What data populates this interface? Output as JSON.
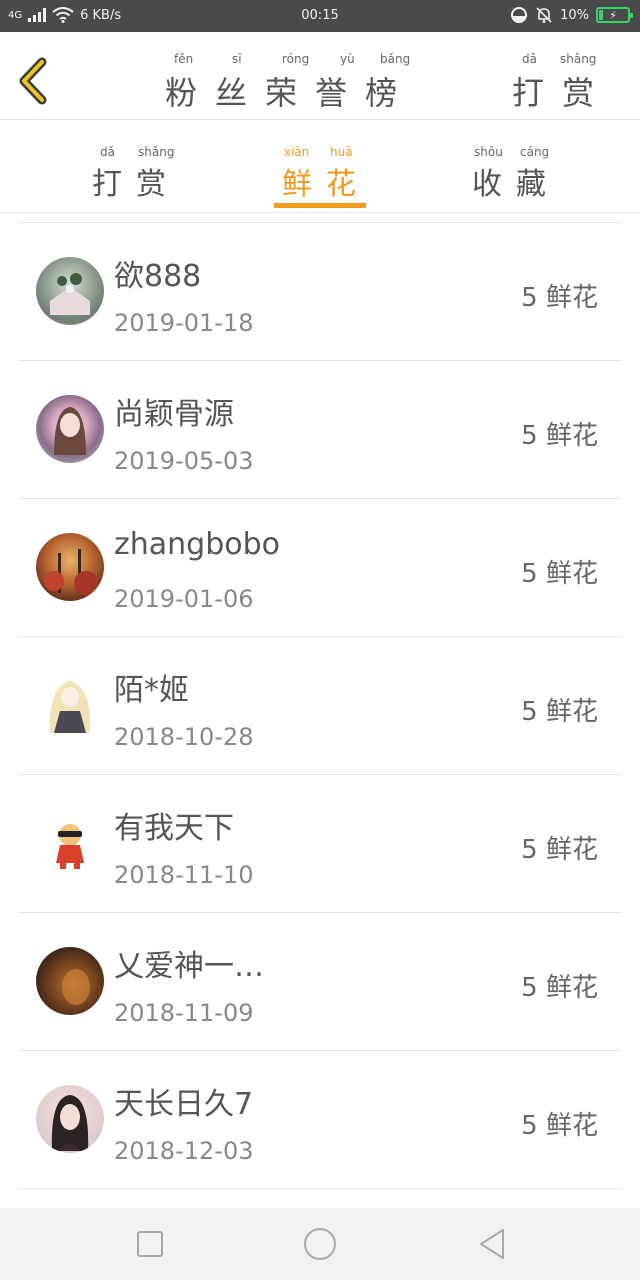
{
  "status_bar": {
    "signal": "4G",
    "speed": "6 KB/s",
    "time": "00:15",
    "battery": "10%",
    "battery_color": "#39d26a"
  },
  "header": {
    "title": "粉丝荣誉榜",
    "title_pinyin": [
      "fěn",
      "sī",
      "róng",
      "yù",
      "bǎng"
    ],
    "reward_link": "打赏",
    "reward_pinyin": [
      "dǎ",
      "shǎng"
    ]
  },
  "tabs": [
    {
      "label": "打赏",
      "pinyin": [
        "dǎ",
        "shǎng"
      ],
      "active": false
    },
    {
      "label": "鲜花",
      "pinyin": [
        "xiān",
        "huā"
      ],
      "active": true
    },
    {
      "label": "收藏",
      "pinyin": [
        "shōu",
        "cáng"
      ],
      "active": false
    }
  ],
  "accent_color": "#ef9a1a",
  "rows": [
    {
      "name": "欲888",
      "date": "2019-01-18",
      "count": "5",
      "unit": "鲜花",
      "avatar": "flowers-photo-avatar"
    },
    {
      "name": "尚颖骨源",
      "date": "2019-05-03",
      "count": "5",
      "unit": "鲜花",
      "avatar": "anime-girl-avatar"
    },
    {
      "name": "zhangbobo",
      "date": "2019-01-06",
      "count": "5",
      "unit": "鲜花",
      "avatar": "autumn-trees-avatar"
    },
    {
      "name": "陌*姬",
      "date": "2018-10-28",
      "count": "5",
      "unit": "鲜花",
      "avatar": "doll-avatar"
    },
    {
      "name": "有我天下",
      "date": "2018-11-10",
      "count": "5",
      "unit": "鲜花",
      "avatar": "cartoon-character-avatar"
    },
    {
      "name": "乂爱神一…",
      "date": "2018-11-09",
      "count": "5",
      "unit": "鲜花",
      "avatar": "dark-photo-avatar"
    },
    {
      "name": "天长日久7",
      "date": "2018-12-03",
      "count": "5",
      "unit": "鲜花",
      "avatar": "girl-portrait-avatar"
    }
  ],
  "navbar": [
    "recent-apps",
    "home",
    "back"
  ]
}
